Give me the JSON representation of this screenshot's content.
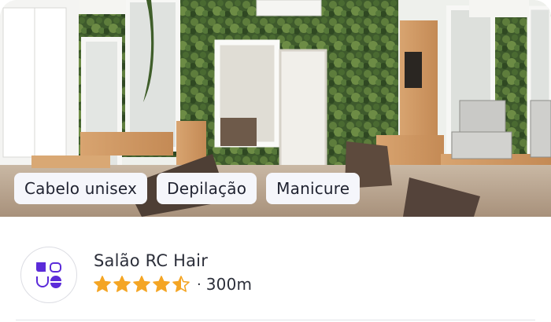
{
  "listing": {
    "photo": {
      "alt": "salon-interior-photo"
    },
    "tags": [
      "Cabelo unisex",
      "Depilação",
      "Manicure"
    ],
    "business_name": "Salão RC Hair",
    "rating": 4.5,
    "rating_max": 5,
    "separator": "·",
    "distance": "300m",
    "logo_icon": "shapes-logo-icon"
  },
  "colors": {
    "star": "#f4a524",
    "brand": "#5b2bd9",
    "chip_bg": "#f5f6fb",
    "text": "#2c2f3a"
  }
}
